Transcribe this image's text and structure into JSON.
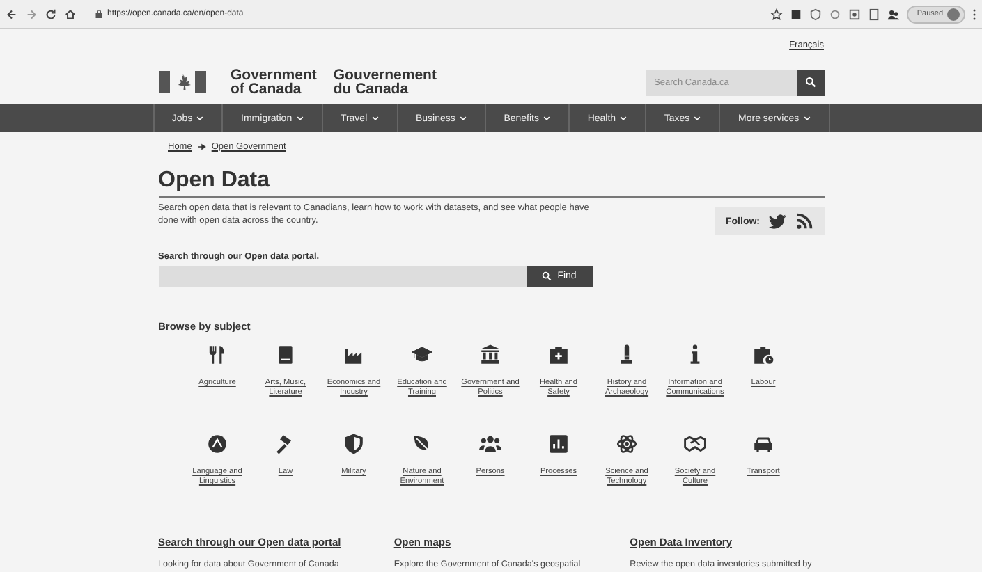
{
  "browser": {
    "url": "https://open.canada.ca/en/open-data",
    "profile_label": "Paused"
  },
  "header": {
    "language_link": "Français",
    "wordmark_en": [
      "Government",
      "of Canada"
    ],
    "wordmark_fr": [
      "Gouvernement",
      "du Canada"
    ],
    "search": {
      "placeholder": "Search Canada.ca"
    }
  },
  "nav": [
    {
      "label": "Jobs"
    },
    {
      "label": "Immigration"
    },
    {
      "label": "Travel"
    },
    {
      "label": "Business"
    },
    {
      "label": "Benefits"
    },
    {
      "label": "Health"
    },
    {
      "label": "Taxes"
    },
    {
      "label": "More services"
    }
  ],
  "breadcrumb": [
    "Home",
    "Open Government"
  ],
  "page": {
    "title": "Open Data",
    "intro": "Search open data that is relevant to Canadians, learn how to work with datasets, and see what people have done with open data across the country.",
    "follow_label": "Follow:"
  },
  "portal_search": {
    "label": "Search through our Open data portal.",
    "button": "Find"
  },
  "browse": {
    "heading": "Browse by subject",
    "subjects": [
      {
        "label": "Agriculture"
      },
      {
        "label": "Arts, Music, Literature"
      },
      {
        "label": "Economics and Industry"
      },
      {
        "label": "Education and Training"
      },
      {
        "label": "Government and Politics"
      },
      {
        "label": "Health and Safety"
      },
      {
        "label": "History and Archaeology"
      },
      {
        "label": "Information and Communications"
      },
      {
        "label": "Labour"
      },
      {
        "label": "Language and Linguistics"
      },
      {
        "label": "Law"
      },
      {
        "label": "Military"
      },
      {
        "label": "Nature and Environment"
      },
      {
        "label": "Persons"
      },
      {
        "label": "Processes"
      },
      {
        "label": "Science and Technology"
      },
      {
        "label": "Society and Culture"
      },
      {
        "label": "Transport"
      }
    ]
  },
  "cards": [
    {
      "title": "Search through our Open data portal",
      "text": "Looking for data about Government of Canada"
    },
    {
      "title": "Open maps",
      "text": "Explore the Government of Canada's geospatial"
    },
    {
      "title": "Open Data Inventory",
      "text": "Review the open data inventories submitted by"
    }
  ]
}
